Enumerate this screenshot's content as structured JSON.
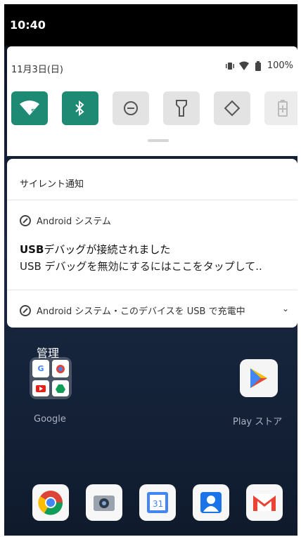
{
  "status_bar": {
    "time": "10:40"
  },
  "quick_settings": {
    "date": "11月3日(日)",
    "battery": "100%",
    "tiles": [
      {
        "icon": "wifi-icon",
        "on": true
      },
      {
        "icon": "bluetooth-icon",
        "on": true
      },
      {
        "icon": "do-not-disturb-icon",
        "on": false
      },
      {
        "icon": "flashlight-icon",
        "on": false
      },
      {
        "icon": "auto-rotate-icon",
        "on": false
      },
      {
        "icon": "battery-saver-icon",
        "on": false
      }
    ],
    "wifi_badge": "5"
  },
  "notifications": {
    "section_title": "サイレント通知",
    "item1": {
      "app": "Android システム",
      "title_bold": "USB",
      "title_rest": "デバッグが接続されました",
      "text": "USB デバッグを無効にするにはここをタップして.."
    },
    "item2": {
      "summary": "Android システム・このデバイスを USB で充電中"
    }
  },
  "home": {
    "folder_label": "管理",
    "folder_app": "Google",
    "play_label": "Play ストア",
    "calendar_day": "31"
  }
}
